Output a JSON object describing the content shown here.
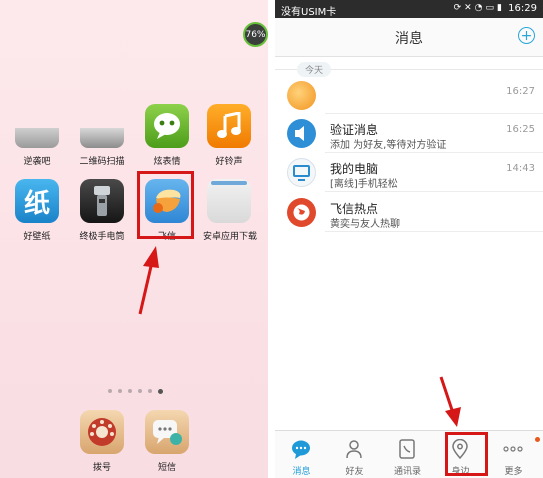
{
  "home": {
    "battery": "76%",
    "apps_row1": [
      {
        "label": "逆袭吧"
      },
      {
        "label": "二维码扫描"
      },
      {
        "label": "炫表情"
      },
      {
        "label": "好铃声"
      }
    ],
    "apps_row2": [
      {
        "label": "好壁纸"
      },
      {
        "label": "终极手电筒"
      },
      {
        "label": "飞信"
      },
      {
        "label": "安卓应用下载"
      }
    ],
    "dock": [
      {
        "label": "拨号"
      },
      {
        "label": "短信"
      }
    ],
    "wallpaper_glyph": "纸"
  },
  "status": {
    "carrier": "没有USIM卡",
    "time": "16:29"
  },
  "messages": {
    "title": "消息",
    "today": "今天",
    "rows": [
      {
        "name": "",
        "preview": "",
        "time": "16:27"
      },
      {
        "name": "验证消息",
        "preview": "添加      为好友,等待对方验证",
        "time": "16:25"
      },
      {
        "name": "我的电脑",
        "preview": "[离线]手机轻松",
        "time": "14:43"
      },
      {
        "name": "飞信热点",
        "preview": "黄奕与友人热聊",
        "time": ""
      }
    ]
  },
  "tabs": [
    {
      "label": "消息"
    },
    {
      "label": "好友"
    },
    {
      "label": "通讯录"
    },
    {
      "label": "身边"
    },
    {
      "label": "更多"
    }
  ],
  "colors": {
    "accent": "#1e9ad8",
    "highlight": "#d61717"
  }
}
